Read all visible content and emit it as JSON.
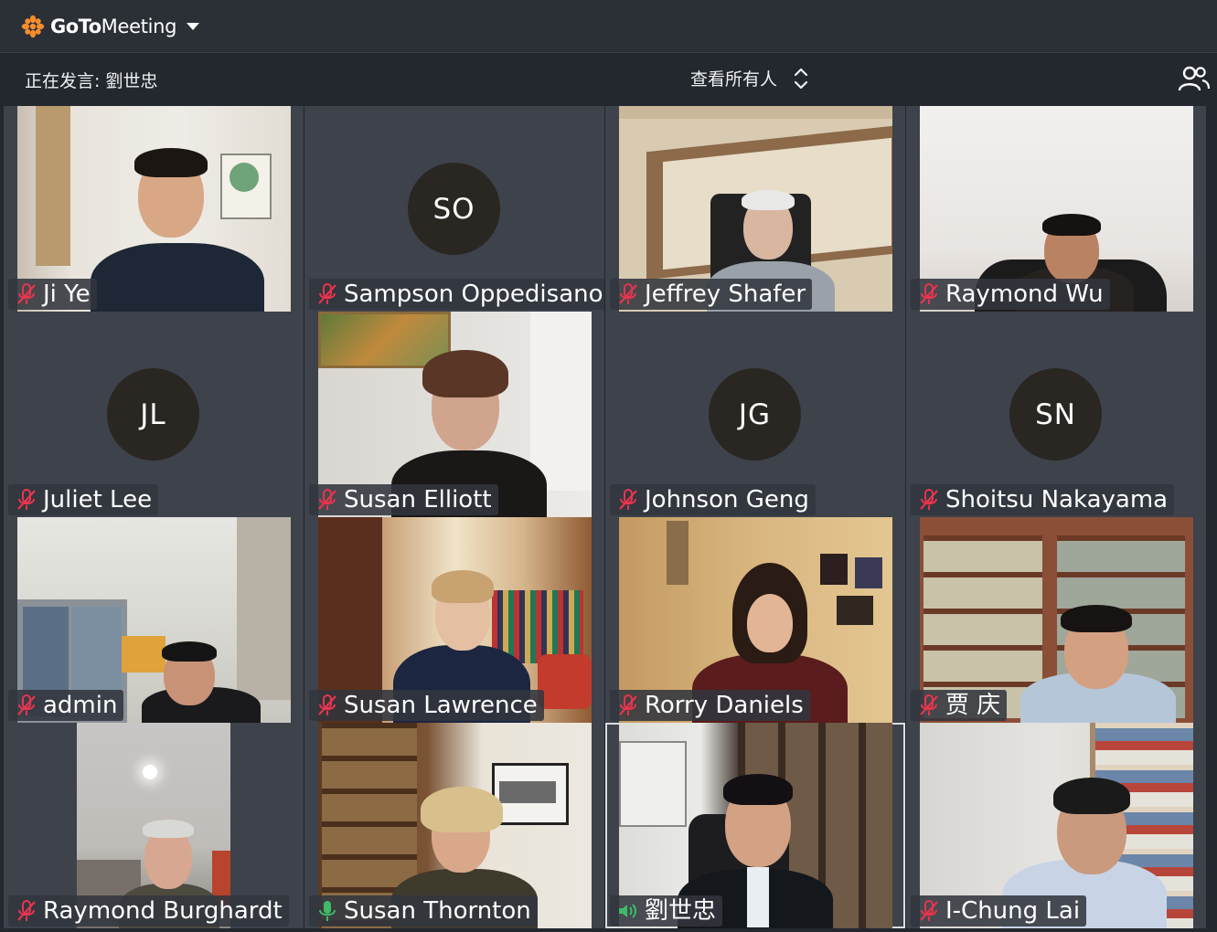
{
  "app": {
    "brand_bold": "GoTo",
    "brand_regular": "Meeting",
    "accent": "#f68d2e"
  },
  "speaker_bar": {
    "speaking_label": "正在发言: 劉世忠",
    "view_selector": "查看所有人",
    "participants_icon": "people-icon"
  },
  "mic_colors": {
    "muted": "#e8344e",
    "unmuted": "#3dbb6a"
  },
  "participants": [
    {
      "name": "Ji Ye",
      "mic": "muted",
      "video": true
    },
    {
      "name": "Sampson Oppedisano",
      "mic": "muted",
      "video": false,
      "initials": "SO"
    },
    {
      "name": "Jeffrey Shafer",
      "mic": "muted",
      "video": true
    },
    {
      "name": "Raymond Wu",
      "mic": "muted",
      "video": true
    },
    {
      "name": "Juliet Lee",
      "mic": "muted",
      "video": false,
      "initials": "JL"
    },
    {
      "name": "Susan Elliott",
      "mic": "muted",
      "video": true
    },
    {
      "name": "Johnson Geng",
      "mic": "muted",
      "video": false,
      "initials": "JG"
    },
    {
      "name": "Shoitsu Nakayama",
      "mic": "muted",
      "video": false,
      "initials": "SN"
    },
    {
      "name": "admin",
      "mic": "muted",
      "video": true
    },
    {
      "name": "Susan Lawrence",
      "mic": "muted",
      "video": true
    },
    {
      "name": "Rorry Daniels",
      "mic": "muted",
      "video": true
    },
    {
      "name": "贾 庆",
      "mic": "muted",
      "video": true
    },
    {
      "name": "Raymond Burghardt",
      "mic": "muted",
      "video": true
    },
    {
      "name": "Susan Thornton",
      "mic": "unmuted",
      "video": true
    },
    {
      "name": "劉世忠",
      "mic": "speaking",
      "video": true,
      "active_speaker": true
    },
    {
      "name": "I-Chung Lai",
      "mic": "muted",
      "video": true
    }
  ]
}
